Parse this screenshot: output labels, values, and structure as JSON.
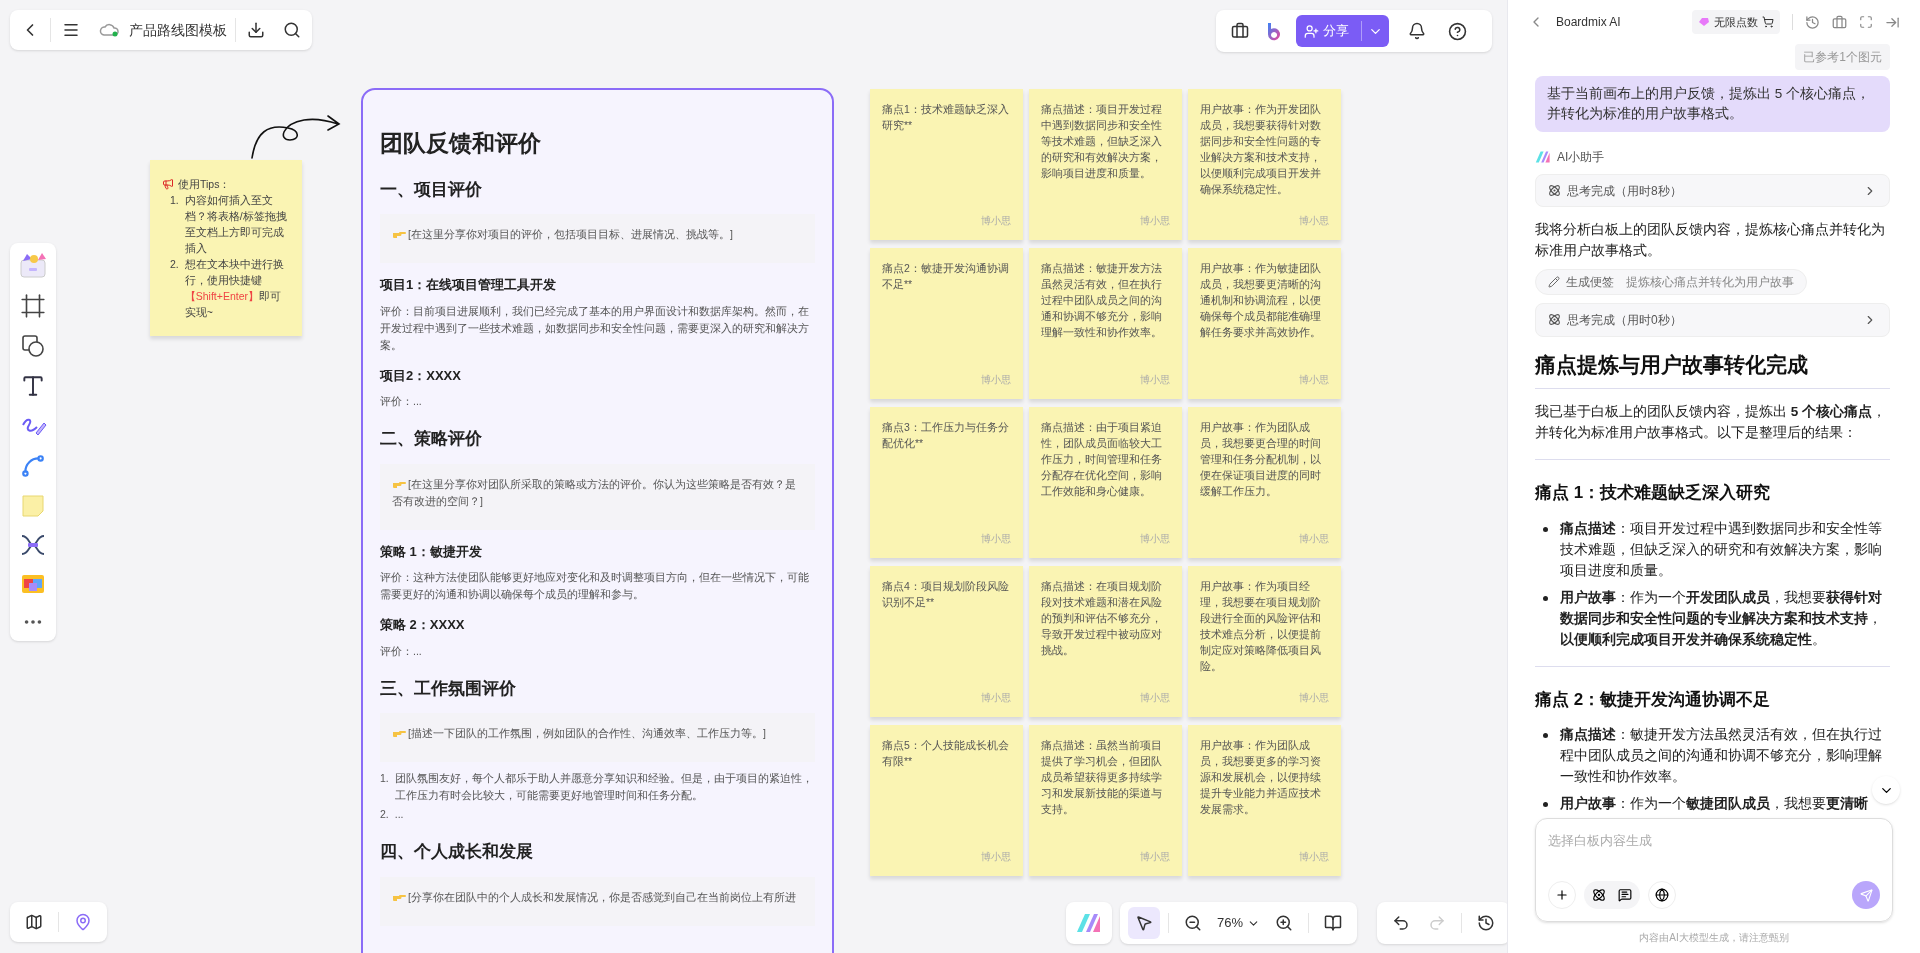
{
  "top_bar": {
    "title": "产品路线图模板"
  },
  "share_button": {
    "label": "分享"
  },
  "tips_note": {
    "heading": "使用Tips：",
    "items": [
      {
        "number": "1.",
        "text": "内容如何插入至文档？将表格/标签拖拽至文档上方即可完成插入"
      },
      {
        "number": "2.",
        "text": "想在文本块中进行换行，使用快捷键",
        "highlight": "【Shift+Enter】",
        "after": "即可实现~"
      }
    ]
  },
  "document": {
    "title": "团队反馈和评价",
    "blocks": [
      {
        "kind": "h2",
        "text": "一、项目评价"
      },
      {
        "kind": "quote",
        "text": "[在这里分享你对项目的评价，包括项目目标、进展情况、挑战等。]"
      },
      {
        "kind": "h3",
        "text": "项目1：在线项目管理工具开发"
      },
      {
        "kind": "p",
        "text": "评价：目前项目进展顺利，我们已经完成了基本的用户界面设计和数据库架构。然而，在开发过程中遇到了一些技术难题，如数据同步和安全性问题，需要更深入的研究和解决方案。"
      },
      {
        "kind": "h3",
        "text": "项目2：XXXX"
      },
      {
        "kind": "p",
        "text": "评价：..."
      },
      {
        "kind": "h2",
        "text": "二、策略评价"
      },
      {
        "kind": "quote",
        "text": "[在这里分享你对团队所采取的策略或方法的评价。你认为这些策略是否有效？是否有改进的空间？]"
      },
      {
        "kind": "h3",
        "text": "策略 1：敏捷开发"
      },
      {
        "kind": "p",
        "text": "评价：这种方法使团队能够更好地应对变化和及时调整项目方向，但在一些情况下，可能需要更好的沟通和协调以确保每个成员的理解和参与。"
      },
      {
        "kind": "h3",
        "text": "策略 2：XXXX"
      },
      {
        "kind": "p",
        "text": "评价：..."
      },
      {
        "kind": "h2",
        "text": "三、工作氛围评价"
      },
      {
        "kind": "quote",
        "text": "[描述一下团队的工作氛围，例如团队的合作性、沟通效率、工作压力等。]"
      },
      {
        "kind": "ol",
        "items": [
          {
            "number": "1.",
            "text": "团队氛围友好，每个人都乐于助人并愿意分享知识和经验。但是，由于项目的紧迫性，工作压力有时会比较大，可能需要更好地管理时间和任务分配。"
          },
          {
            "number": "2.",
            "text": "..."
          }
        ]
      },
      {
        "kind": "h2",
        "text": "四、个人成长和发展"
      },
      {
        "kind": "quote",
        "text": "[分享你在团队中的个人成长和发展情况，你是否感觉到自己在当前岗位上有所进"
      }
    ]
  },
  "sticky_notes": [
    {
      "text": "痛点1：技术难题缺乏深入研究**",
      "author": "博小思"
    },
    {
      "text": "痛点描述：项目开发过程中遇到数据同步和安全性等技术难题，但缺乏深入的研究和有效解决方案，影响项目进度和质量。",
      "author": "博小思"
    },
    {
      "text": "用户故事：作为开发团队成员，我想要获得针对数据同步和安全性问题的专业解决方案和技术支持，以便顺利完成项目开发并确保系统稳定性。",
      "author": "博小思"
    },
    {
      "text": "痛点2：敏捷开发沟通协调不足**",
      "author": "博小思"
    },
    {
      "text": "痛点描述：敏捷开发方法虽然灵活有效，但在执行过程中团队成员之间的沟通和协调不够充分，影响理解一致性和协作效率。",
      "author": "博小思"
    },
    {
      "text": "用户故事：作为敏捷团队成员，我想要更清晰的沟通机制和协调流程，以便确保每个成员都能准确理解任务要求并高效协作。",
      "author": "博小思"
    },
    {
      "text": "痛点3：工作压力与任务分配优化**",
      "author": "博小思"
    },
    {
      "text": "痛点描述：由于项目紧迫性，团队成员面临较大工作压力，时间管理和任务分配存在优化空间，影响工作效能和身心健康。",
      "author": "博小思"
    },
    {
      "text": "用户故事：作为团队成员，我想要更合理的时间管理和任务分配机制，以便在保证项目进度的同时缓解工作压力。",
      "author": "博小思"
    },
    {
      "text": "痛点4：项目规划阶段风险识别不足**",
      "author": "博小思"
    },
    {
      "text": "痛点描述：在项目规划阶段对技术难题和潜在风险的预判和评估不够充分，导致开发过程中被动应对挑战。",
      "author": "博小思"
    },
    {
      "text": "用户故事：作为项目经理，我想要在项目规划阶段进行全面的风险评估和技术难点分析，以便提前制定应对策略降低项目风险。",
      "author": "博小思"
    },
    {
      "text": "痛点5：个人技能成长机会有限**",
      "author": "博小思"
    },
    {
      "text": "痛点描述：虽然当前项目提供了学习机会，但团队成员希望获得更多持续学习和发展新技能的渠道与支持。",
      "author": "博小思"
    },
    {
      "text": "用户故事：作为团队成员，我想要更多的学习资源和发展机会，以便持续提升专业能力并适应技术发展需求。",
      "author": "博小思"
    }
  ],
  "zoom_control": {
    "value": "76%"
  },
  "history_buttons": {
    "undo": {
      "disabled": false
    },
    "redo": {
      "disabled": true
    }
  },
  "ai_panel": {
    "title": "Boardmix AI",
    "points_badge": "无限点数",
    "reference_chip": "已参考1个图元",
    "user_message": "基于当前画布上的用户反馈，提炼出 5 个核心痛点，并转化为标准的用户故事格式。",
    "assistant_name": "AI小助手",
    "thinking_1": "思考完成（用时8秒）",
    "reply_text": "我将分析白板上的团队反馈内容，提炼核心痛点并转化为标准用户故事格式。",
    "action_chip": {
      "label": "生成便签",
      "text": "提炼核心痛点并转化为用户故事"
    },
    "thinking_2": "思考完成（用时0秒）",
    "heading": "痛点提炼与用户故事转化完成",
    "intro": "我已基于白板上的团队反馈内容，提炼出 **5 个核心痛点**，并转化为标准用户故事格式。以下是整理后的结果：",
    "sections": [
      {
        "heading": "痛点 1：技术难题缺乏深入研究",
        "bullets": [
          "**痛点描述**：项目开发过程中遇到数据同步和安全性等技术难题，但缺乏深入的研究和有效解决方案，影响项目进度和质量。",
          "**用户故事**：作为一个**开发团队成员**，我想要**获得针对数据同步和安全性问题的专业解决方案和技术支持**，**以便顺利完成项目开发并确保系统稳定性**。"
        ]
      },
      {
        "heading": "痛点 2：敏捷开发沟通协调不足",
        "bullets": [
          "**痛点描述**：敏捷开发方法虽然灵活有效，但在执行过程中团队成员之间的沟通和协调不够充分，影响理解一致性和协作效率。",
          "**用户故事**：作为一个**敏捷团队成员**，我想要**更清晰**"
        ]
      }
    ],
    "input_placeholder": "选择白板内容生成",
    "disclaimer": "内容由AI大模型生成，请注意甄别"
  }
}
